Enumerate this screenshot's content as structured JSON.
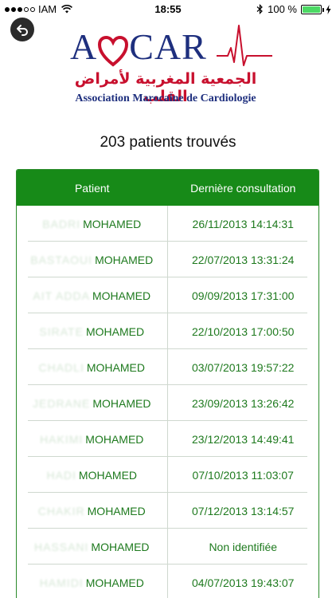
{
  "status_bar": {
    "carrier": "IAM",
    "time": "18:55",
    "battery": "100 %"
  },
  "logo": {
    "word_left": "A",
    "word_right": "CAR",
    "arabic": "الجمعية المغربية لأمراض القلب",
    "subtitle": "Association Marocaine de Cardiologie",
    "colors": {
      "blue": "#1e2f7e",
      "red": "#c8102e"
    }
  },
  "results": {
    "count_label": "203 patients trouvés"
  },
  "table": {
    "header": {
      "patient": "Patient",
      "last_consultation": "Dernière consultation"
    },
    "rows": [
      {
        "surname_redacted": "BADRI",
        "name": "MOHAMED",
        "date": "26/11/2013 14:14:31"
      },
      {
        "surname_redacted": "BASTAOUI",
        "name": "MOHAMED",
        "date": "22/07/2013 13:31:24"
      },
      {
        "surname_redacted": "AIT ADDA",
        "name": "MOHAMED",
        "date": "09/09/2013 17:31:00"
      },
      {
        "surname_redacted": "SIRATE",
        "name": "MOHAMED",
        "date": "22/10/2013 17:00:50"
      },
      {
        "surname_redacted": "CHADLI",
        "name": "MOHAMED",
        "date": "03/07/2013 19:57:22"
      },
      {
        "surname_redacted": "JEDRANE",
        "name": "MOHAMED",
        "date": "23/09/2013 13:26:42"
      },
      {
        "surname_redacted": "HAKIMI",
        "name": "MOHAMED",
        "date": "23/12/2013 14:49:41"
      },
      {
        "surname_redacted": "HADI",
        "name": "MOHAMED",
        "date": "07/10/2013 11:03:07"
      },
      {
        "surname_redacted": "CHAKIR",
        "name": "MOHAMED",
        "date": "07/12/2013 13:14:57"
      },
      {
        "surname_redacted": "HASSANI",
        "name": "MOHAMED",
        "date": "Non identifiée"
      },
      {
        "surname_redacted": "HAMIDI",
        "name": "MOHAMED",
        "date": "04/07/2013 19:43:07"
      }
    ],
    "colors": {
      "header_bg": "#178a18",
      "text": "#1e7a1e"
    }
  }
}
